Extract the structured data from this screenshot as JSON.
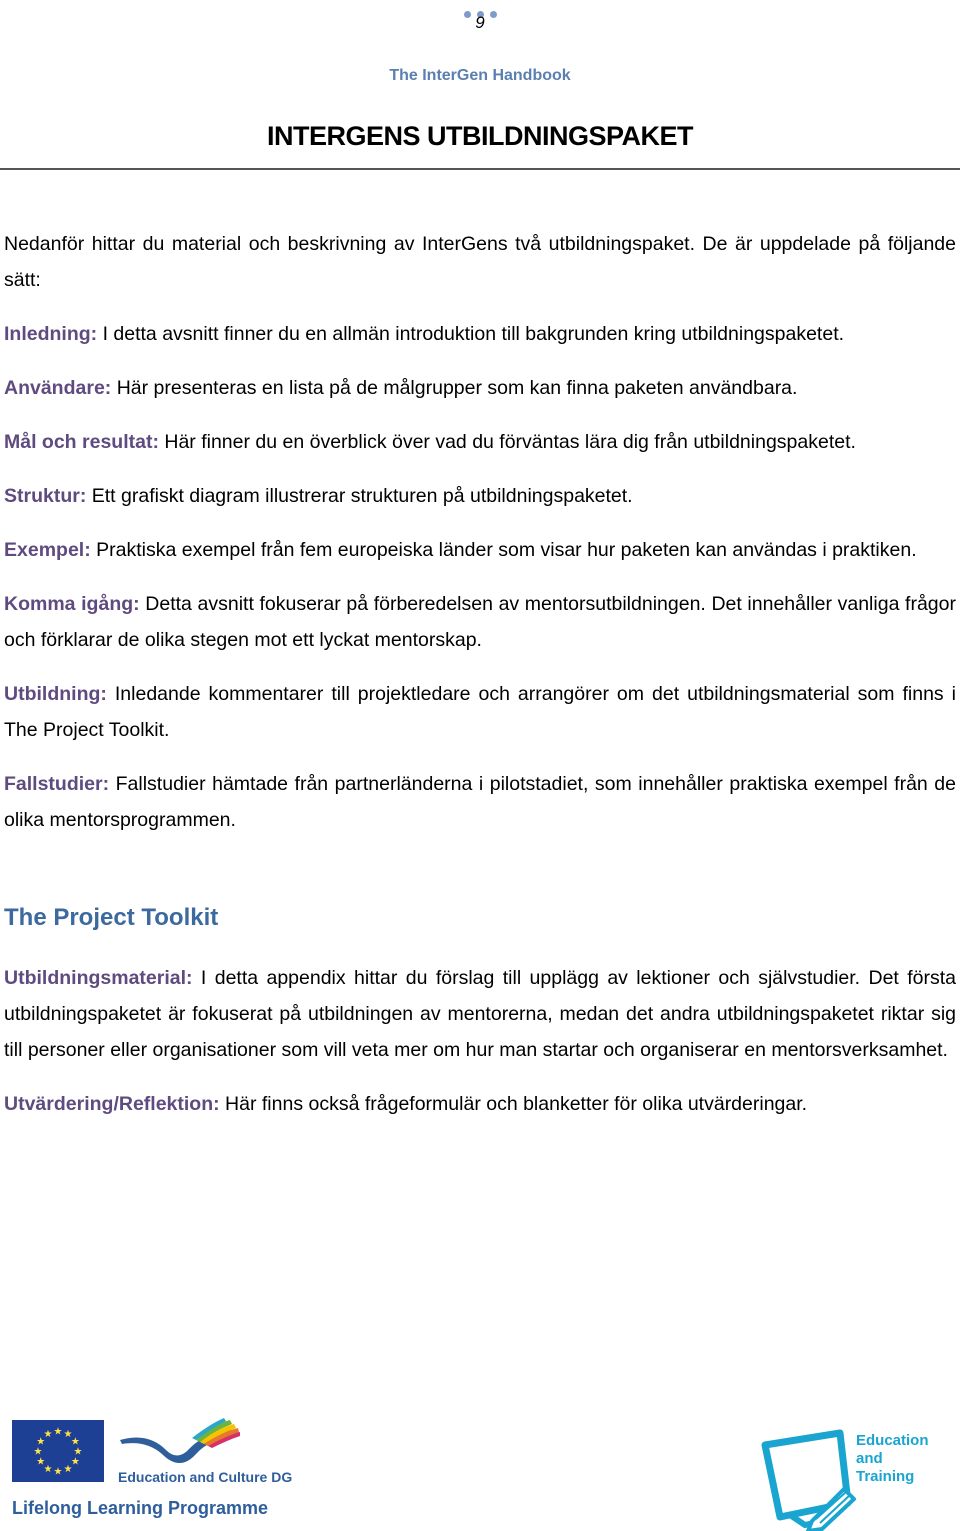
{
  "header": {
    "page_number": "9",
    "handbook_title": "The InterGen Handbook",
    "main_title": "INTERGENS UTBILDNINGSPAKET"
  },
  "intro": "Nedanför hittar du material och beskrivning av InterGens två utbildningspaket. De är uppdelade på följande sätt:",
  "sections": [
    {
      "label": "Inledning:",
      "text": " I detta avsnitt finner du en allmän introduktion till bakgrunden kring utbildningspaketet."
    },
    {
      "label": "Användare:",
      "text": " Här presenteras en lista på de målgrupper som kan finna paketen användbara."
    },
    {
      "label": "Mål och resultat:",
      "text": " Här finner du en överblick över vad du förväntas lära dig från utbildningspaketet."
    },
    {
      "label": "Struktur:",
      "text": " Ett grafiskt diagram illustrerar strukturen på utbildningspaketet."
    },
    {
      "label": "Exempel:",
      "text": " Praktiska exempel från fem europeiska länder som visar hur paketen kan användas i praktiken."
    },
    {
      "label": "Komma igång:",
      "text": " Detta avsnitt fokuserar på förberedelsen av mentorsutbildningen. Det innehåller vanliga frågor och förklarar de olika stegen mot ett lyckat mentorskap."
    },
    {
      "label": "Utbildning:",
      "text": " Inledande kommentarer till projektledare och arrangörer om det utbildningsmaterial som finns i The Project Toolkit."
    },
    {
      "label": "Fallstudier:",
      "text": " Fallstudier hämtade från partnerländerna i pilotstadiet, som innehåller praktiska exempel från de olika mentorsprogrammen."
    }
  ],
  "toolkit": {
    "heading": "The Project Toolkit",
    "items": [
      {
        "label": "Utbildningsmaterial:",
        "text": " I detta appendix hittar du förslag till upplägg av lektioner och självstudier. Det första utbildningspaketet är fokuserat på utbildningen av mentorerna, medan det andra utbildningspaketet riktar sig till personer eller organisationer som vill veta mer om hur man startar och organiserar en mentorsverksamhet."
      },
      {
        "label": "Utvärdering/Reflektion:",
        "text": " Här finns också frågeformulär och blanketter för olika utvärderingar."
      }
    ]
  },
  "footer": {
    "edu_culture": "Education and Culture DG",
    "llp": "Lifelong Learning Programme",
    "et_line1": "Education",
    "et_line2": "and",
    "et_line3": "Training"
  },
  "colors": {
    "label_purple": "#5f4b7f",
    "heading_blue": "#3d6a9e",
    "handbook_blue": "#5a7fb0",
    "eu_blue": "#1d3f94",
    "et_cyan": "#1aa5d0"
  }
}
